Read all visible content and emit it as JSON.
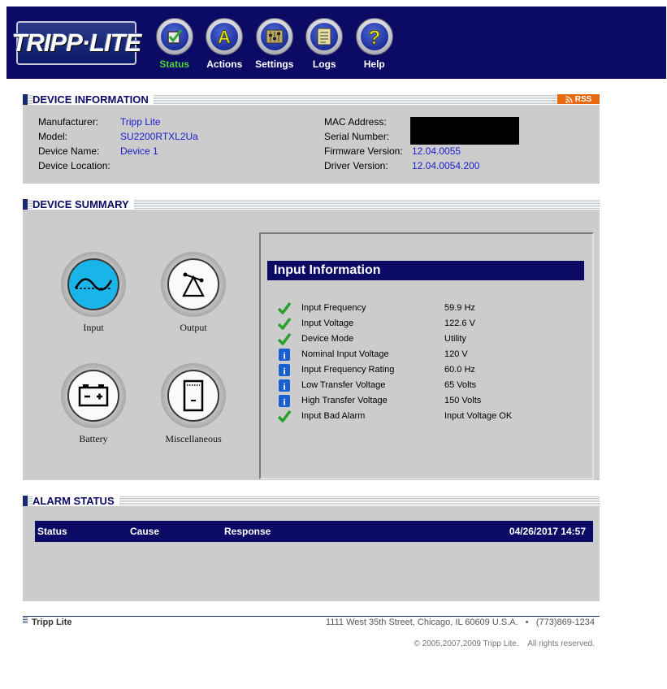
{
  "header": {
    "logo_text": "TRIPP·LITE",
    "nav": [
      {
        "label": "Status",
        "icon": "status-checkbox-icon",
        "active": true
      },
      {
        "label": "Actions",
        "icon": "actions-a-icon",
        "active": false
      },
      {
        "label": "Settings",
        "icon": "settings-sliders-icon",
        "active": false
      },
      {
        "label": "Logs",
        "icon": "logs-document-icon",
        "active": false
      },
      {
        "label": "Help",
        "icon": "help-question-icon",
        "active": false
      }
    ]
  },
  "device_information": {
    "title": "DEVICE INFORMATION",
    "rss_label": "RSS",
    "left": [
      {
        "label": "Manufacturer:",
        "value": "Tripp Lite"
      },
      {
        "label": "Model:",
        "value": "SU2200RTXL2Ua"
      },
      {
        "label": "Device Name:",
        "value": "Device 1"
      },
      {
        "label": "Device Location:",
        "value": ""
      }
    ],
    "right": [
      {
        "label": "MAC Address:",
        "value": ""
      },
      {
        "label": "Serial Number:",
        "value": ""
      },
      {
        "label": "Firmware Version:",
        "value": "12.04.0055"
      },
      {
        "label": "Driver Version:",
        "value": "12.04.0054.200"
      }
    ]
  },
  "device_summary": {
    "title": "DEVICE SUMMARY",
    "icons": [
      {
        "label": "Input",
        "icon": "input-sine-wave-icon",
        "selected": true
      },
      {
        "label": "Output",
        "icon": "output-power-icon",
        "selected": false
      },
      {
        "label": "Battery",
        "icon": "battery-icon",
        "selected": false
      },
      {
        "label": "Miscellaneous",
        "icon": "miscellaneous-device-icon",
        "selected": false
      }
    ],
    "panel_title": "Input Information",
    "params": [
      {
        "name": "Input Frequency",
        "value": "59.9 Hz",
        "status": "ok"
      },
      {
        "name": "Input Voltage",
        "value": "122.6 V",
        "status": "ok"
      },
      {
        "name": "Device Mode",
        "value": "Utility",
        "status": "ok"
      },
      {
        "name": "Nominal Input Voltage",
        "value": "120 V",
        "status": "info"
      },
      {
        "name": "Input Frequency Rating",
        "value": "60.0 Hz",
        "status": "info"
      },
      {
        "name": "Low Transfer Voltage",
        "value": "65 Volts",
        "status": "info"
      },
      {
        "name": "High Transfer Voltage",
        "value": "150 Volts",
        "status": "info"
      },
      {
        "name": "Input Bad Alarm",
        "value": "Input Voltage OK",
        "status": "ok"
      }
    ]
  },
  "alarm_status": {
    "title": "ALARM STATUS",
    "columns": [
      "Status",
      "Cause",
      "Response"
    ],
    "timestamp": "04/26/2017 14:57"
  },
  "footer": {
    "brand": "Tripp Lite",
    "address": "1111 West 35th Street, Chicago, IL 60609 U.S.A.   •   (773)869-1234",
    "copyright": "© 2005,2007,2009 Tripp Lite.    All rights reserved."
  },
  "colors": {
    "header_bg": "#0b0b66",
    "panel_bg": "#cccccc",
    "link_blue": "#1c1ccc",
    "ok_green": "#2aa02a",
    "info_blue": "#1a5fd0",
    "rss_orange": "#e86a10",
    "active_nav": "#4cd43c"
  }
}
